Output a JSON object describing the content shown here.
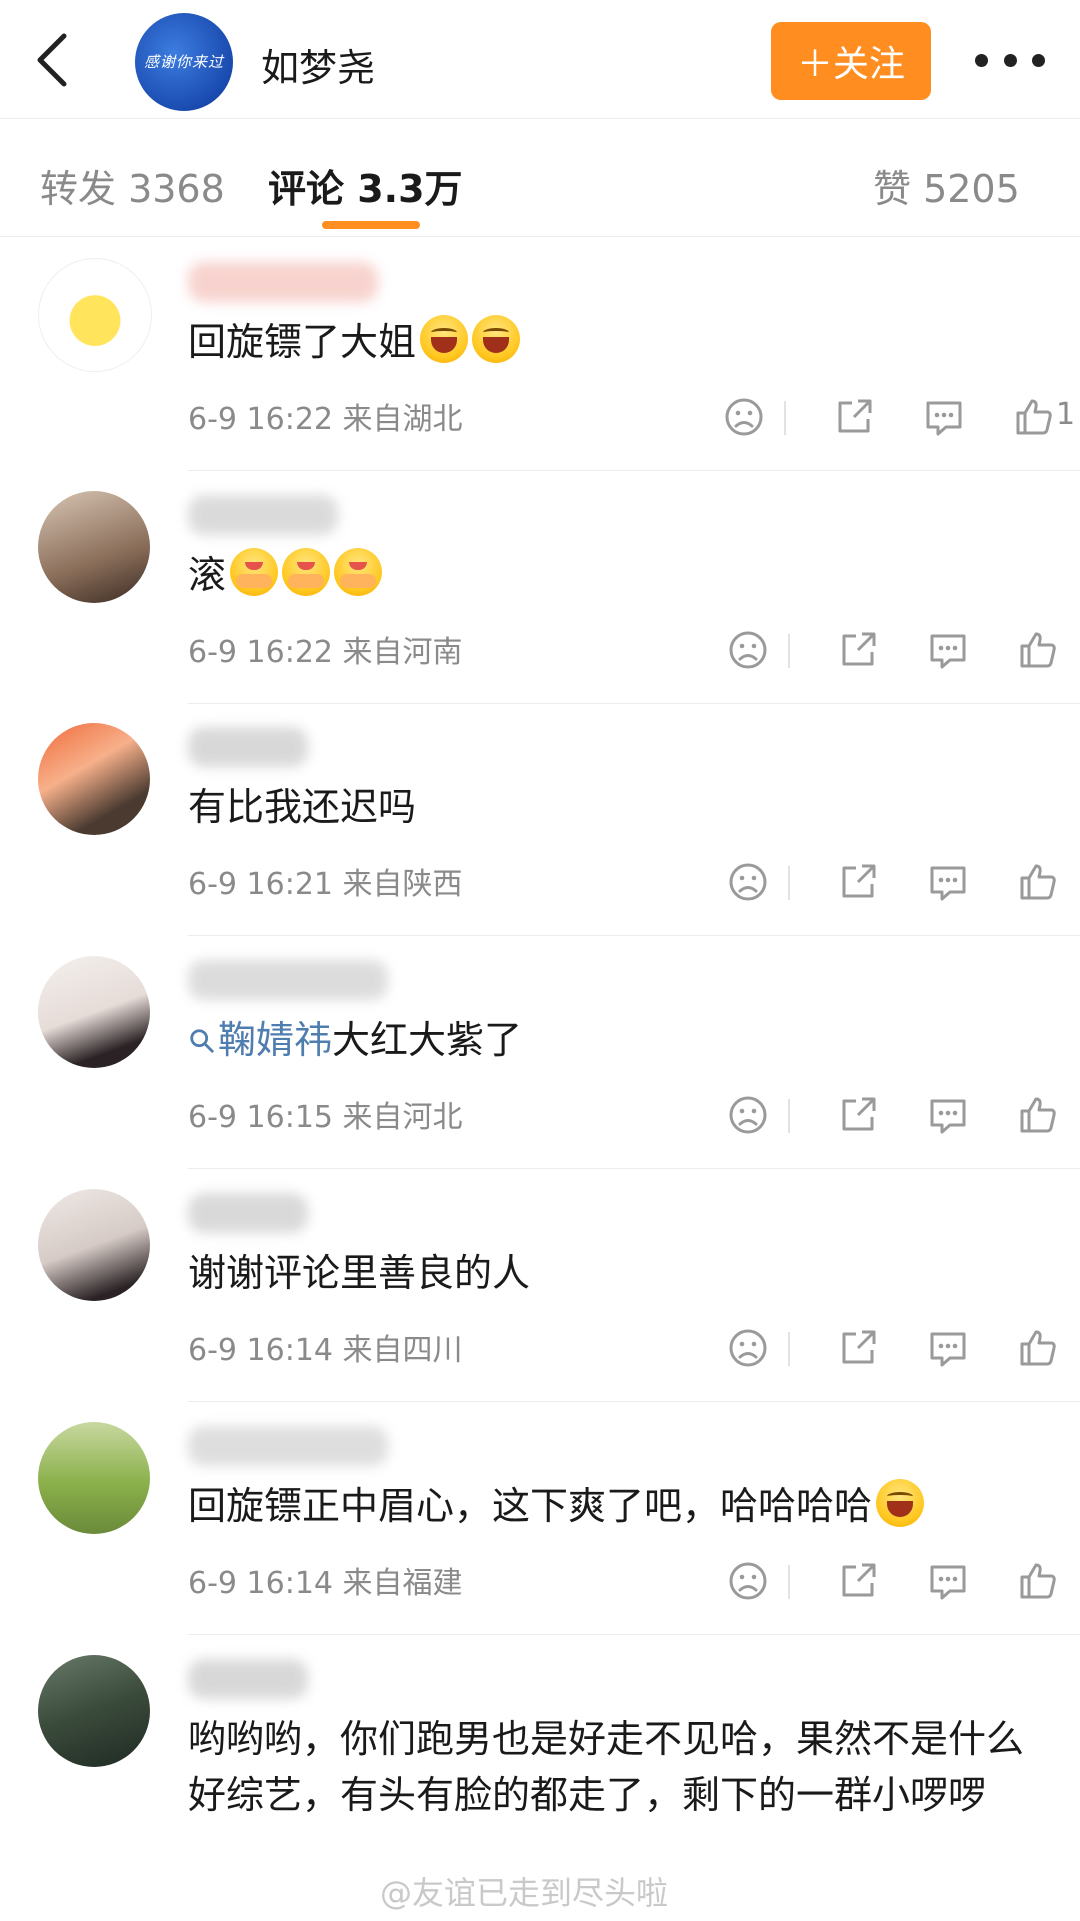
{
  "header": {
    "avatar_text": "感谢你来过",
    "user_name": "如梦尧",
    "follow_label": "＋关注"
  },
  "tabs": {
    "repost": "转发 3368",
    "comments": "评论 3.3万",
    "likes": "赞 5205"
  },
  "comments": [
    {
      "text": "回旋镖了大姐",
      "emojis": [
        "laugh",
        "laugh"
      ],
      "time": "6-9 16:22",
      "location": "来自湖北",
      "like_count": "1"
    },
    {
      "text": "滚",
      "emojis": [
        "hug",
        "hug",
        "hug"
      ],
      "time": "6-9 16:22",
      "location": "来自河南",
      "like_count": ""
    },
    {
      "text": "有比我还迟吗",
      "emojis": [],
      "time": "6-9 16:21",
      "location": "来自陕西",
      "like_count": ""
    },
    {
      "topic": "鞠婧祎",
      "text": "大红大紫了",
      "emojis": [],
      "time": "6-9 16:15",
      "location": "来自河北",
      "like_count": ""
    },
    {
      "text": "谢谢评论里善良的人",
      "emojis": [],
      "time": "6-9 16:14",
      "location": "来自四川",
      "like_count": ""
    },
    {
      "text": "回旋镖正中眉心，这下爽了吧，哈哈哈哈",
      "emojis": [
        "laugh"
      ],
      "time": "6-9 16:14",
      "location": "来自福建",
      "like_count": ""
    },
    {
      "text": "哟哟哟，你们跑男也是好走不见哈，果然不是什么好综艺，有头有脸的都走了，剩下的一群小啰啰",
      "emojis": [],
      "time": "",
      "location": "",
      "like_count": ""
    }
  ],
  "watermark": "@友谊已走到尽头啦",
  "colors": {
    "accent": "#ff8d1f",
    "link": "#507daf",
    "meta": "#8a8a8a"
  }
}
